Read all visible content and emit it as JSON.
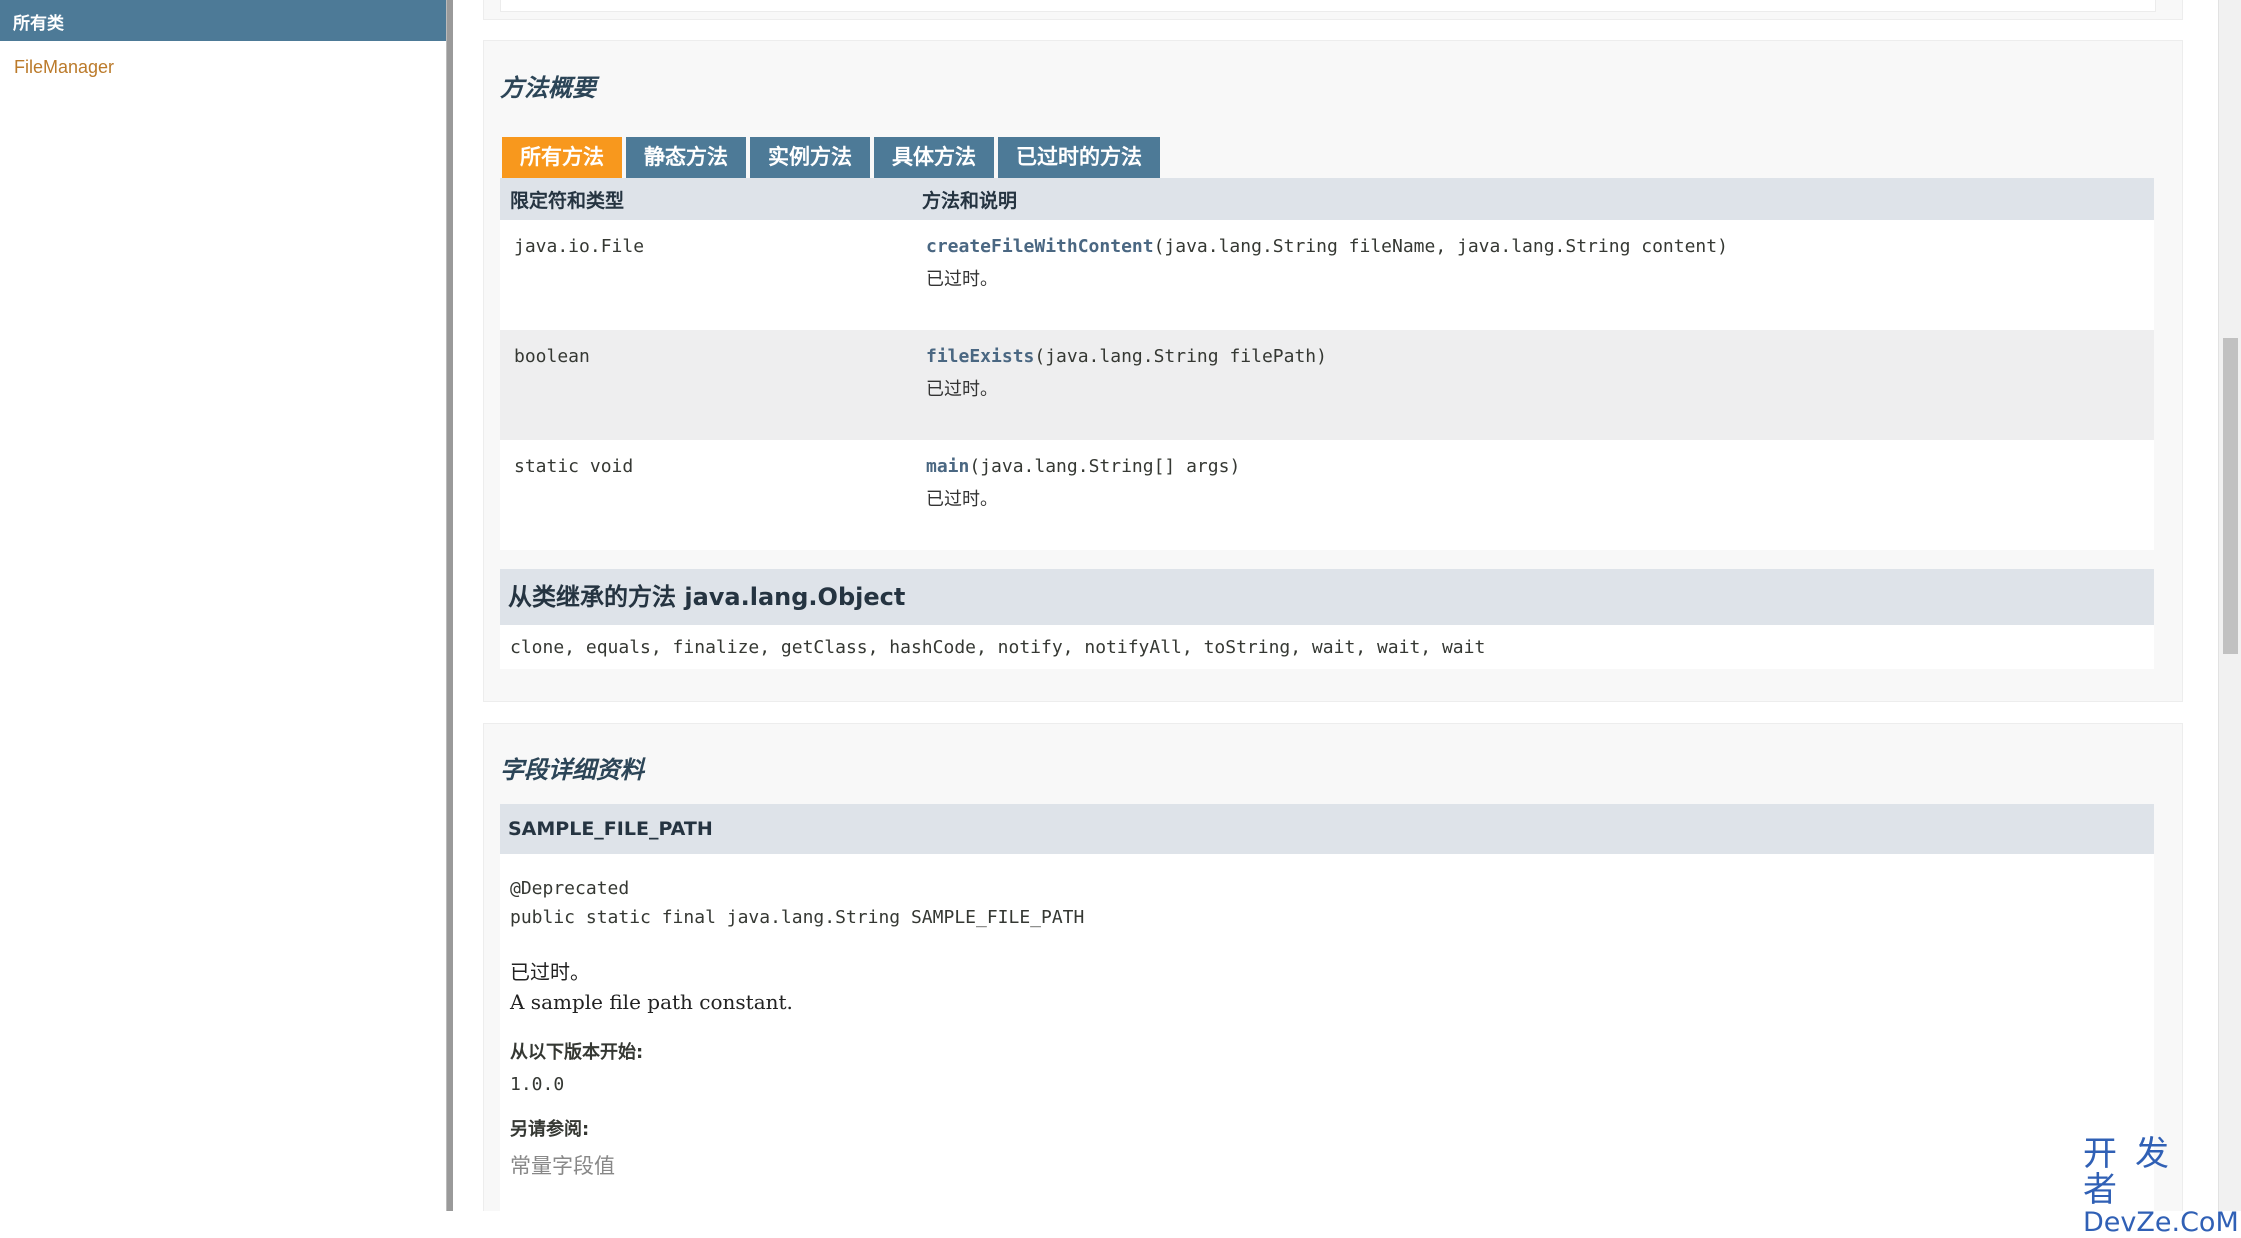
{
  "left_frame": {
    "header": "所有类",
    "classes": [
      "FileManager"
    ]
  },
  "method_summary": {
    "title": "方法概要",
    "tabs": [
      {
        "label": "所有方法",
        "active": true
      },
      {
        "label": "静态方法",
        "active": false
      },
      {
        "label": "实例方法",
        "active": false
      },
      {
        "label": "具体方法",
        "active": false
      },
      {
        "label": "已过时的方法",
        "active": false
      }
    ],
    "col_modifier": "限定符和类型",
    "col_method": "方法和说明",
    "rows": [
      {
        "type": "java.io.File",
        "name": "createFileWithContent",
        "params": "(java.lang.String  fileName, java.lang.String  content)",
        "note": "已过时。"
      },
      {
        "type": "boolean",
        "name": "fileExists",
        "params": "(java.lang.String  filePath)",
        "note": "已过时。"
      },
      {
        "type": "static void",
        "name": "main",
        "params": "(java.lang.String[]  args)",
        "note": "已过时。"
      }
    ],
    "inherited_title": "从类继承的方法 java.lang.Object",
    "inherited_methods": "clone, equals, finalize, getClass, hashCode, notify, notifyAll, toString, wait, wait, wait"
  },
  "field_detail": {
    "title": "字段详细资料",
    "field_name": "SAMPLE_FILE_PATH",
    "annotation": "@Deprecated",
    "signature": "public static final  java.lang.String SAMPLE_FILE_PATH",
    "deprecated": "已过时。",
    "description": "A sample file path constant.",
    "since_label": "从以下版本开始:",
    "since_value": "1.0.0",
    "see_also_label": "另请参阅:",
    "see_also_link": "常量字段值"
  },
  "watermark": {
    "cn": "开发者",
    "en": "DevZe.CoM"
  },
  "colors": {
    "header_blue": "#4D7A97",
    "tab_active": "#F8981D",
    "table_header": "#dee3e9",
    "link_orange": "#bb7a2a"
  }
}
